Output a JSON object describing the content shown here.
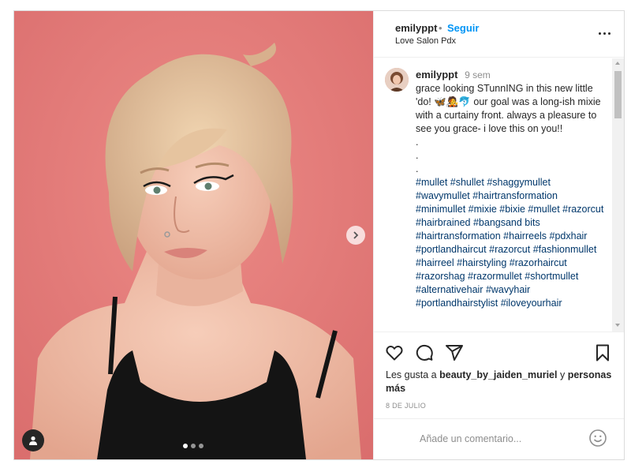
{
  "post": {
    "username": "emilyppt",
    "separator": "•",
    "follow_label": "Seguir",
    "location": "Love Salon Pdx",
    "more_icon": "more-horizontal-icon"
  },
  "media": {
    "carousel_count": 3,
    "carousel_active": 1,
    "next_icon": "chevron-right-icon",
    "tag_icon": "user-tag-icon"
  },
  "caption": {
    "username": "emilyppt",
    "time": "9 sem",
    "text_line1": "grace looking STunnING in this new little 'do! 🦋🧑‍🎤🐬 our goal was a long-ish mixie with a curtainy front. always a pleasure to see you grace- i love this on you!!",
    "dot1": ".",
    "dot2": ".",
    "dot3": ".",
    "hashtags": "#mullet #shullet #shaggymullet #wavymullet #hairtransformation #minimullet #mixie #bixie #mullet #razorcut #hairbrained #bangsand bits #hairtransformation #hairreels #pdxhair #portlandhaircut #razorcut #fashionmullet #hairreel #hairstyling #razorhaircut #razorshag #razormullet #shortmullet #alternativehair #wavyhair #portlandhairstylist #iloveyourhair"
  },
  "actions": {
    "like_icon": "heart-icon",
    "comment_icon": "comment-icon",
    "share_icon": "share-icon",
    "save_icon": "bookmark-icon"
  },
  "likes": {
    "prefix": "Les gusta a ",
    "user": "beauty_by_jaiden_muriel",
    "middle": " y ",
    "suffix": "personas más"
  },
  "date": "8 DE JULIO",
  "comment_box": {
    "placeholder": "Añade un comentario...",
    "emoji_icon": "emoji-icon"
  },
  "colors": {
    "accent": "#0095f6",
    "hashtag": "#00376b",
    "background_photo": "#e17a7a"
  }
}
